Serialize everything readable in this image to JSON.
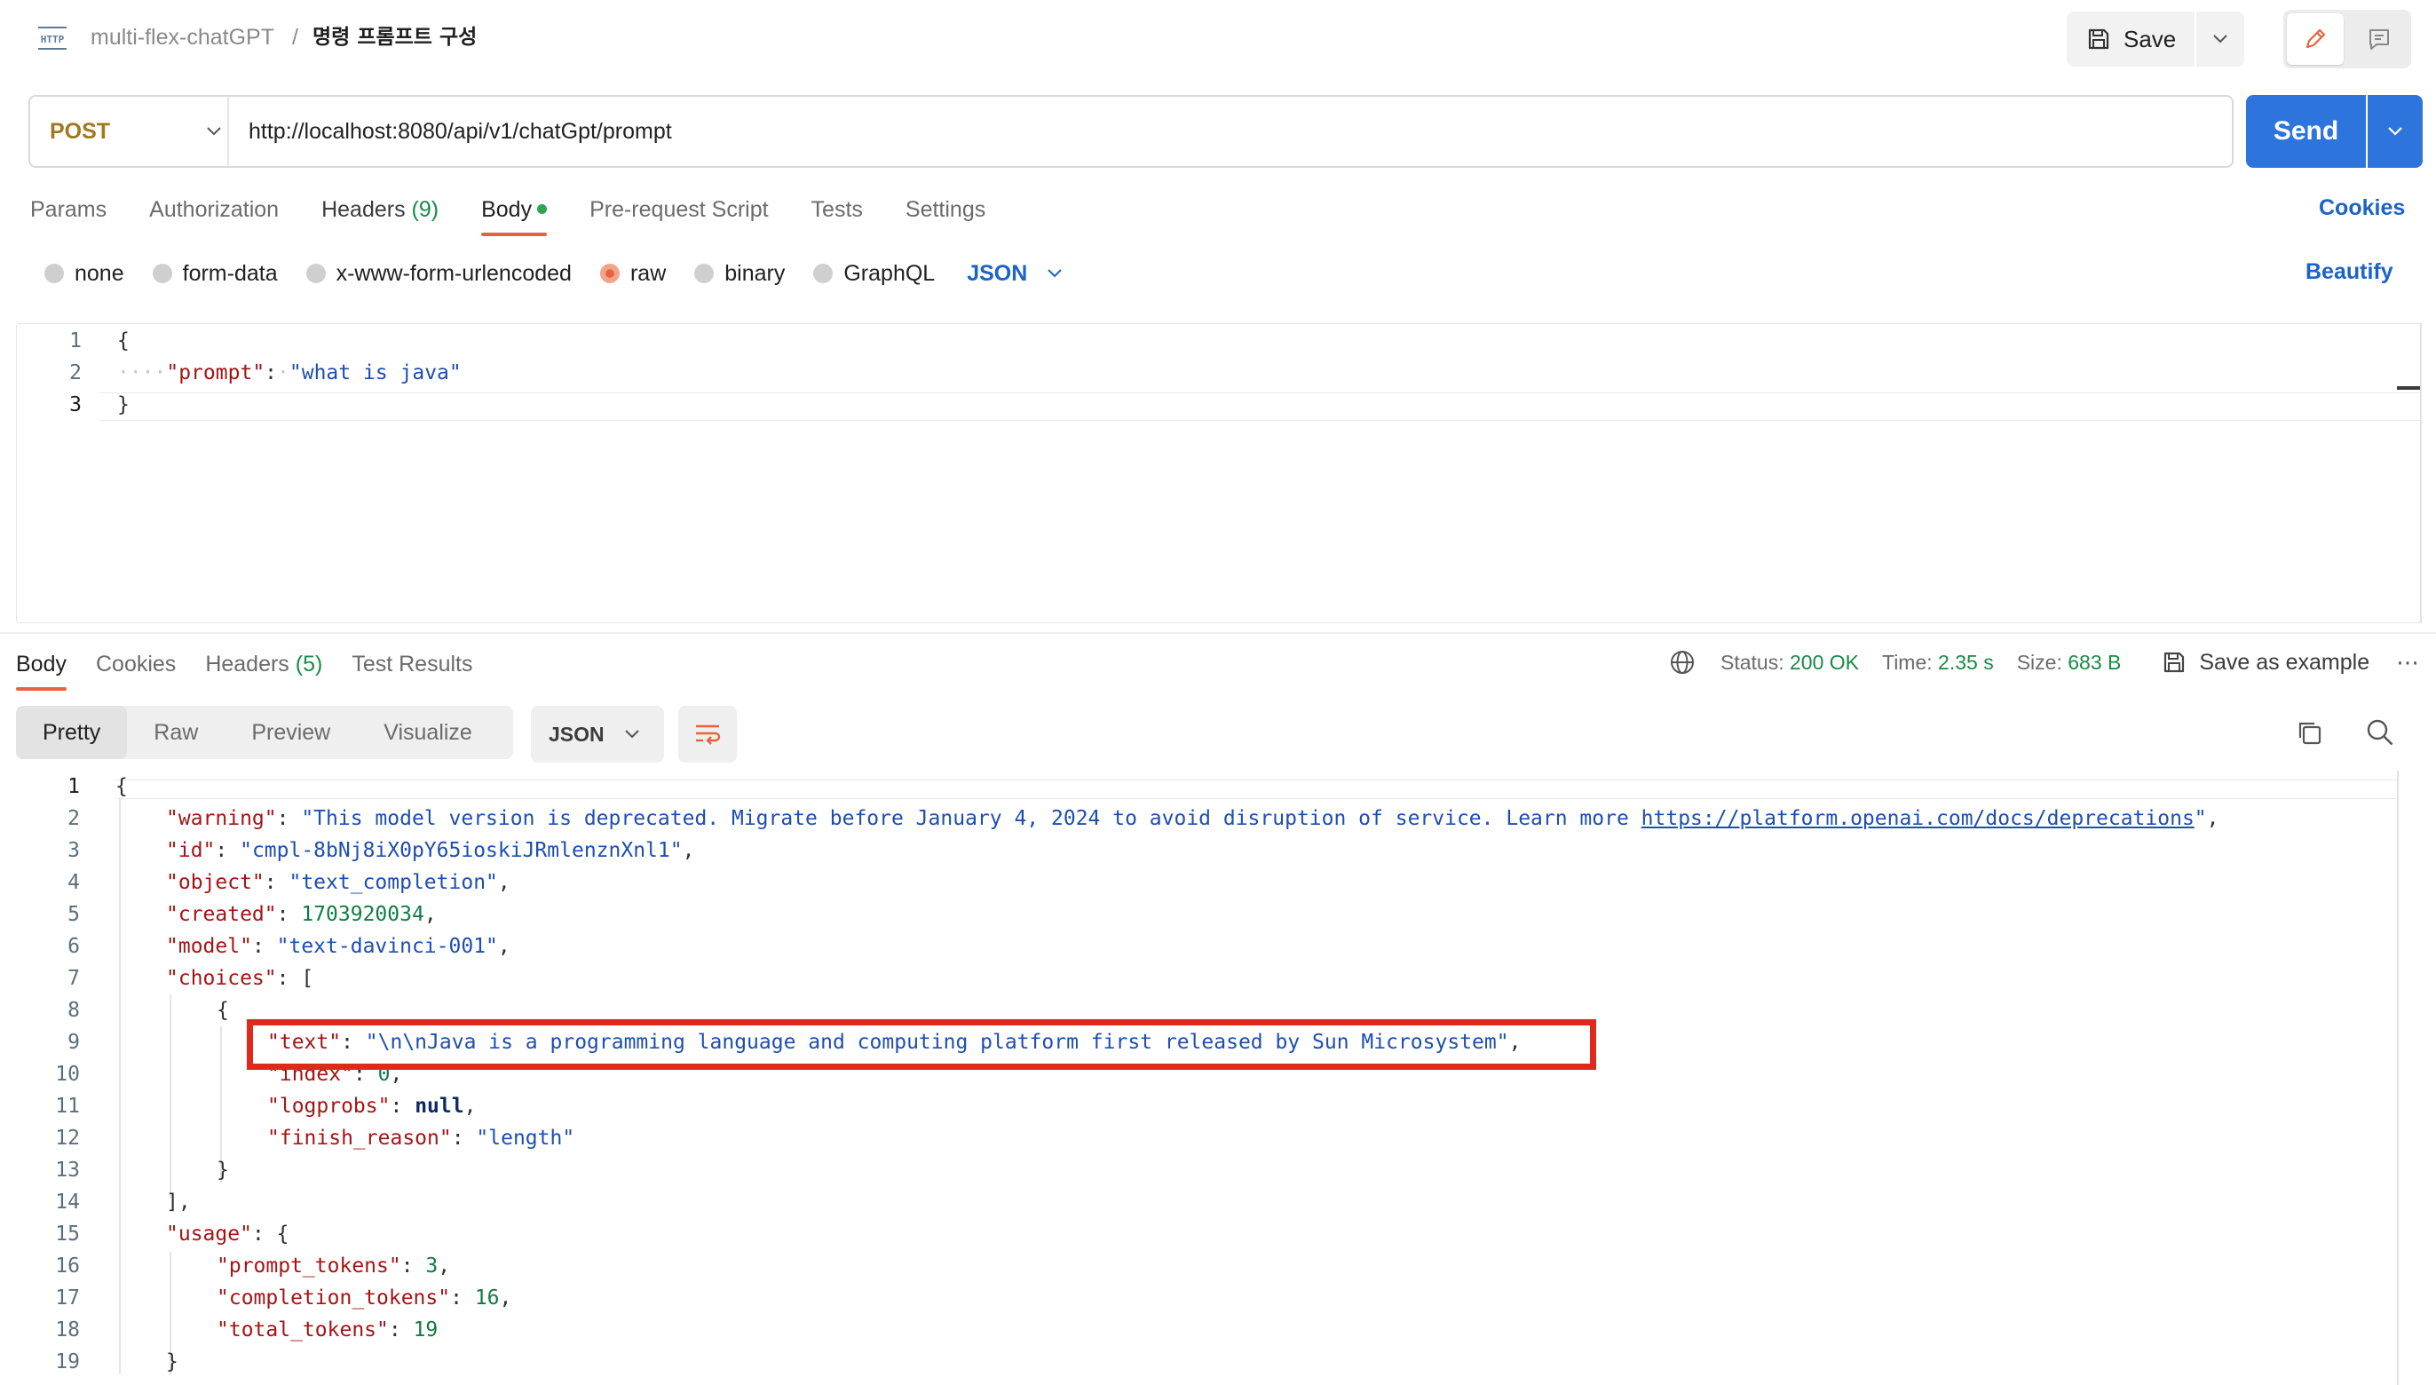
{
  "header": {
    "collection": "multi-flex-chatGPT",
    "separator": "/",
    "request_name": "명령 프롬프트 구성",
    "save_label": "Save"
  },
  "request": {
    "method": "POST",
    "url": "http://localhost:8080/api/v1/chatGpt/prompt",
    "send_label": "Send",
    "tabs": {
      "params": "Params",
      "authorization": "Authorization",
      "headers": "Headers",
      "headers_count": "(9)",
      "body": "Body",
      "prerequest": "Pre-request Script",
      "tests": "Tests",
      "settings": "Settings"
    },
    "cookies_label": "Cookies",
    "body_types": {
      "none": "none",
      "form_data": "form-data",
      "urlencoded": "x-www-form-urlencoded",
      "raw": "raw",
      "binary": "binary",
      "graphql": "GraphQL"
    },
    "body_format": "JSON",
    "selected_body_type": "raw",
    "beautify_label": "Beautify",
    "body_lines": {
      "l1": "{",
      "l2_key": "\"prompt\"",
      "l2_val": "\"what is java\"",
      "l3": "}"
    }
  },
  "response": {
    "tabs": {
      "body": "Body",
      "cookies": "Cookies",
      "headers": "Headers",
      "headers_count": "(5)",
      "test_results": "Test Results"
    },
    "status_label": "Status:",
    "status_value": "200 OK",
    "time_label": "Time:",
    "time_value": "2.35 s",
    "size_label": "Size:",
    "size_value": "683 B",
    "save_example_label": "Save as example",
    "views": {
      "pretty": "Pretty",
      "raw": "Raw",
      "preview": "Preview",
      "visualize": "Visualize"
    },
    "format": "JSON",
    "json": {
      "warning_key": "\"warning\"",
      "warning_val_text": "\"This model version is deprecated. Migrate before January 4, 2024 to avoid disruption of service. Learn more ",
      "warning_link": "https://platform.openai.com/docs/deprecations",
      "warning_val_end": "\"",
      "id_key": "\"id\"",
      "id_val": "\"cmpl-8bNj8iX0pY65ioskiJRmlenznXnl1\"",
      "object_key": "\"object\"",
      "object_val": "\"text_completion\"",
      "created_key": "\"created\"",
      "created_val": "1703920034",
      "model_key": "\"model\"",
      "model_val": "\"text-davinci-001\"",
      "choices_key": "\"choices\"",
      "text_key": "\"text\"",
      "text_val": "\"\\n\\nJava is a programming language and computing platform first released by Sun Microsystem\"",
      "index_key": "\"index\"",
      "index_val": "0",
      "logprobs_key": "\"logprobs\"",
      "logprobs_val": "null",
      "finish_key": "\"finish_reason\"",
      "finish_val": "\"length\"",
      "usage_key": "\"usage\"",
      "prompt_tokens_key": "\"prompt_tokens\"",
      "prompt_tokens_val": "3",
      "completion_tokens_key": "\"completion_tokens\"",
      "completion_tokens_val": "16",
      "total_tokens_key": "\"total_tokens\"",
      "total_tokens_val": "19"
    },
    "line_numbers": [
      "1",
      "2",
      "3",
      "4",
      "5",
      "6",
      "7",
      "8",
      "9",
      "10",
      "11",
      "12",
      "13",
      "14",
      "15",
      "16",
      "17",
      "18",
      "19"
    ]
  },
  "colors": {
    "accent_orange": "#e8633b",
    "send_blue": "#2e74dd",
    "link_blue": "#1c63c7",
    "success_green": "#198a47",
    "highlight_red": "#e0291c"
  }
}
